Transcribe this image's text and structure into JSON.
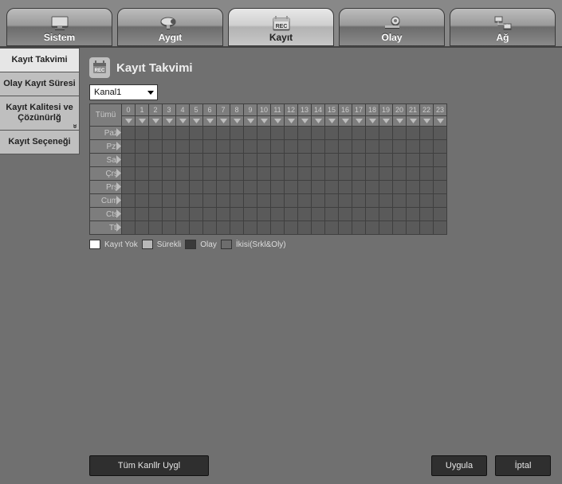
{
  "topTabs": [
    {
      "label": "Sistem",
      "icon": "monitor"
    },
    {
      "label": "Aygıt",
      "icon": "camera"
    },
    {
      "label": "Kayıt",
      "icon": "rec",
      "active": true
    },
    {
      "label": "Olay",
      "icon": "gear"
    },
    {
      "label": "Ağ",
      "icon": "network"
    }
  ],
  "sidebar": {
    "items": [
      {
        "label": "Kayıt Takvimi",
        "active": true
      },
      {
        "label": "Olay Kayıt Süresi"
      },
      {
        "label": "Kayıt Kalitesi ve Çözünürlğ",
        "expandable": true
      },
      {
        "label": "Kayıt Seçeneği"
      }
    ]
  },
  "page": {
    "title": "Kayıt Takvimi",
    "channel": "Kanal1",
    "allLabel": "Tümü",
    "hours": [
      "0",
      "1",
      "2",
      "3",
      "4",
      "5",
      "6",
      "7",
      "8",
      "9",
      "10",
      "11",
      "12",
      "13",
      "14",
      "15",
      "16",
      "17",
      "18",
      "19",
      "20",
      "21",
      "22",
      "23"
    ],
    "days": [
      "Paz",
      "Pzt",
      "Sal",
      "Çrş",
      "Prş",
      "Cum",
      "Cts",
      "Ttl"
    ]
  },
  "legend": {
    "none": "Kayıt Yok",
    "cont": "Sürekli",
    "evt": "Olay",
    "both": "İkisi(Srkl&Oly)"
  },
  "buttons": {
    "applyAll": "Tüm Kanllr Uygl",
    "apply": "Uygula",
    "cancel": "İptal"
  }
}
